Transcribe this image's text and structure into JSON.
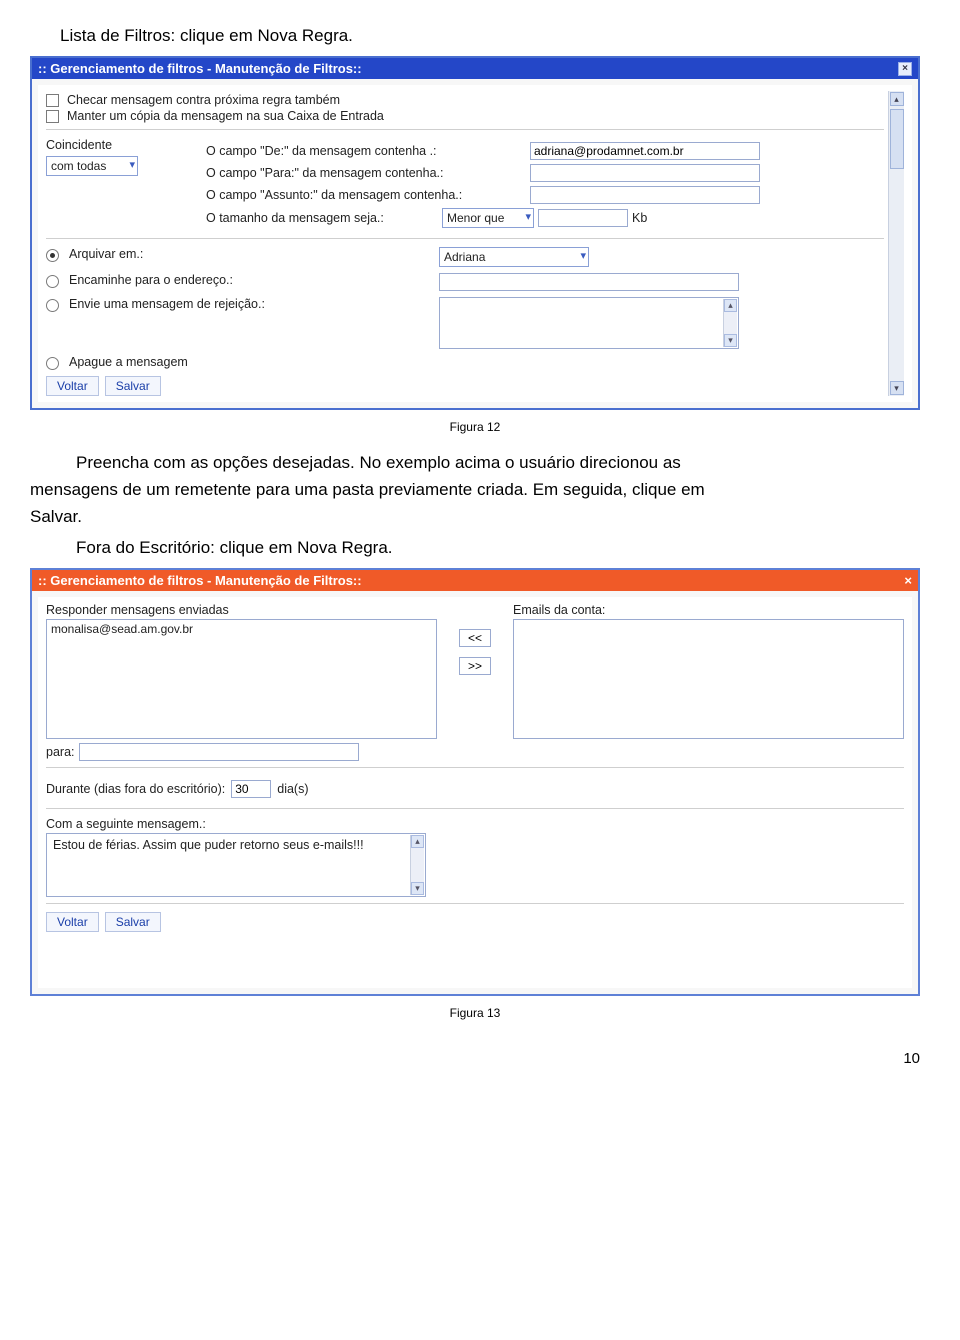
{
  "doc": {
    "intro_line": "Lista de Filtros: clique em Nova Regra.",
    "caption1": "Figura 12",
    "para1_a": "Preencha com as opções desejadas. No exemplo acima o usuário direcionou as",
    "para1_b": "mensagens de um remetente para uma pasta previamente criada. Em seguida, clique em",
    "para1_c": "Salvar.",
    "para2": "Fora do Escritório: clique em Nova Regra.",
    "caption2": "Figura 13",
    "page_number": "10"
  },
  "win1": {
    "title": ":: Gerenciamento de filtros - Manutenção de Filtros::",
    "chk1": "Checar mensagem contra próxima regra também",
    "chk2": "Manter um cópia da mensagem na sua Caixa de Entrada",
    "coincidente_label": "Coincidente",
    "coincidente_value": "com todas",
    "field_de_label": "O campo \"De:\" da mensagem contenha .:",
    "field_de_value": "adriana@prodamnet.com.br",
    "field_para_label": "O campo \"Para:\" da mensagem contenha.:",
    "field_assunto_label": "O campo \"Assunto:\" da mensagem contenha.:",
    "field_tamanho_label": "O tamanho da mensagem seja.:",
    "tamanho_op": "Menor que",
    "tamanho_unit": "Kb",
    "act_arquivar": "Arquivar em.:",
    "act_arquivar_value": "Adriana",
    "act_encaminhe": "Encaminhe para o endereço.:",
    "act_rejeicao": "Envie uma mensagem de rejeição.:",
    "act_apague": "Apague a mensagem",
    "btn_voltar": "Voltar",
    "btn_salvar": "Salvar"
  },
  "win2": {
    "title": ":: Gerenciamento de filtros - Manutenção de Filtros::",
    "left_label": "Responder mensagens enviadas",
    "left_value": "monalisa@sead.am.gov.br",
    "right_label": "Emails da conta:",
    "move_left": "<<",
    "move_right": ">>",
    "para_label": "para:",
    "dias_prefix": "Durante (dias fora do escritório):",
    "dias_value": "30",
    "dias_suffix": "dia(s)",
    "msg_label": "Com a seguinte mensagem.:",
    "msg_value": "Estou de férias. Assim que puder retorno seus e-mails!!!",
    "btn_voltar": "Voltar",
    "btn_salvar": "Salvar"
  }
}
